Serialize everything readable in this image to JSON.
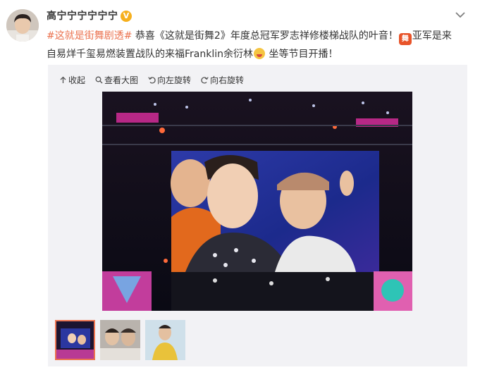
{
  "user": {
    "name": "高宁宁宁宁宁宁",
    "verified_icon": "verified-badge",
    "verified_color": "#f6b01e"
  },
  "post": {
    "line1_hashtag": "#这就是街舞剧透#",
    "line1_text": " 恭喜《这就是街舞2》年度总冠军罗志祥修楼梯战队的叶音！",
    "badge_icon": "dance-badge-icon",
    "line1_tail": "亚军是来",
    "line2_text": "自易烊千玺易燃装置战队的来福Franklin余衍林",
    "emoji_icon": "grinning-emoji",
    "line2_tail": " 坐等节目开播！"
  },
  "toolbar": {
    "collapse_label": "收起",
    "view_large_label": "查看大图",
    "rotate_left_label": "向左旋转",
    "rotate_right_label": "向右旋转"
  },
  "thumbnails": [
    "thumb-1",
    "thumb-2",
    "thumb-3"
  ],
  "colors": {
    "accent": "#eb7350",
    "media_bg": "#f2f2f5"
  }
}
